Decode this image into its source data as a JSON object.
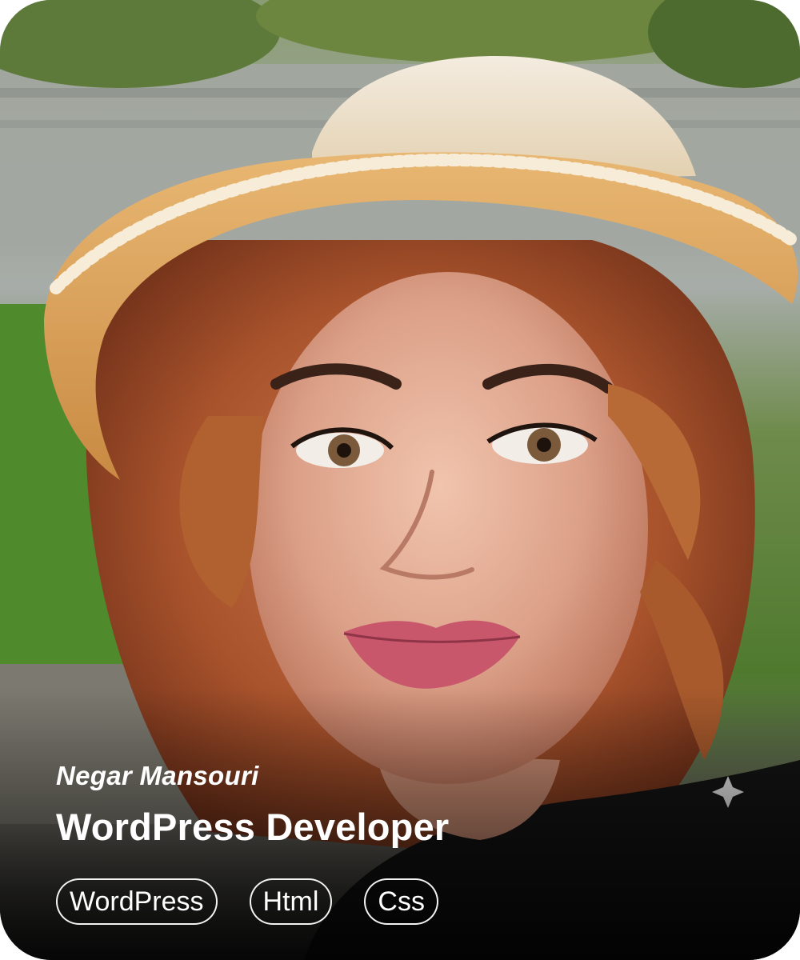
{
  "profile": {
    "name": "Negar Mansouri",
    "role": "WordPress Developer"
  },
  "tags": [
    "WordPress",
    "Html",
    "Css"
  ]
}
